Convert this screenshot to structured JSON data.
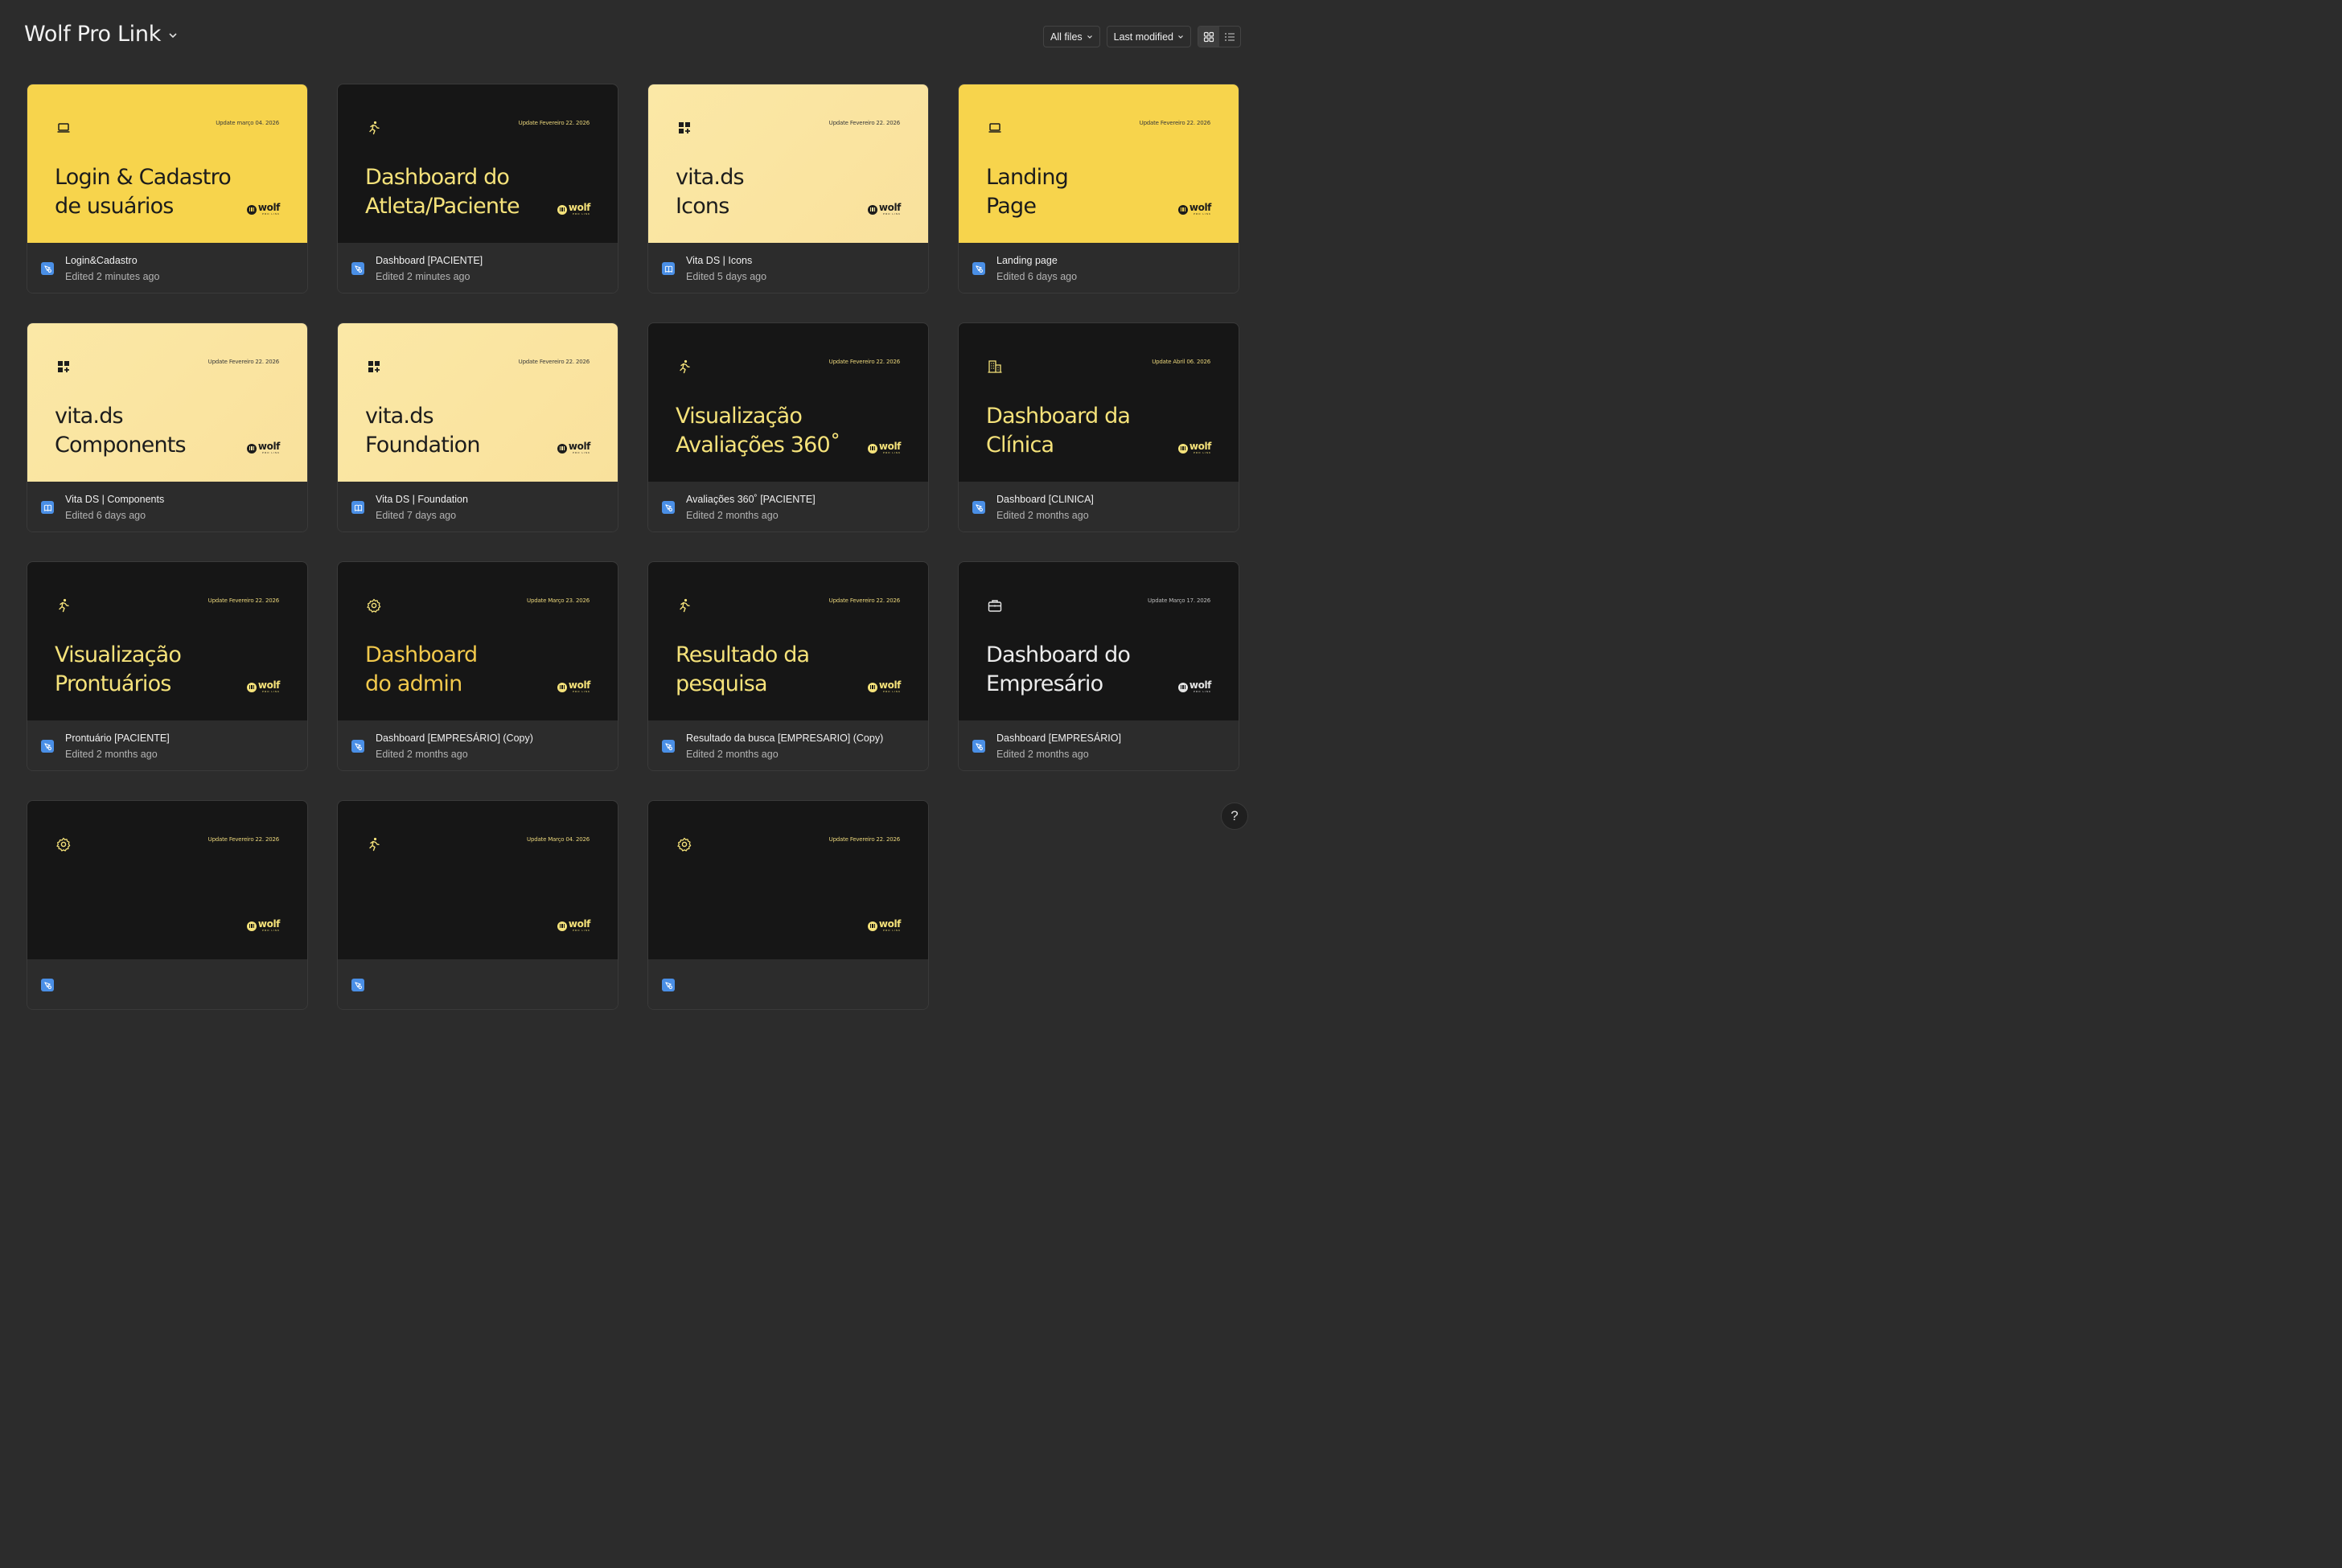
{
  "header": {
    "project_title": "Wolf Pro Link",
    "filter_label": "All files",
    "sort_label": "Last modified"
  },
  "colors": {
    "background": "#2c2c2c",
    "yellow": "#f7d44c",
    "cream": "#fbe8a6",
    "dark": "#161616",
    "accent_text": "#f5e27a",
    "file_icon_blue": "#4a8fe6"
  },
  "files": [
    {
      "theme": "yellow",
      "icon": "laptop-icon",
      "date": "Update março 04. 2026",
      "title": [
        "Login & Cadastro",
        "de usuários"
      ],
      "title_color": "dark",
      "file_type": "design-file-icon",
      "name": "Login&Cadastro",
      "edited": "Edited 2 minutes ago"
    },
    {
      "theme": "dark",
      "icon": "running-person-icon",
      "date": "Update Fevereiro 22. 2026",
      "title": [
        "Dashboard do",
        "Atleta/Paciente"
      ],
      "title_color": "yellow",
      "file_type": "design-file-icon",
      "name": "Dashboard [PACIENTE]",
      "edited": "Edited 2 minutes ago"
    },
    {
      "theme": "cream",
      "icon": "widgets-icon",
      "date": "Update Fevereiro 22. 2026",
      "title": [
        "vita.ds",
        "Icons"
      ],
      "title_color": "dark",
      "file_type": "library-file-icon",
      "name": "Vita DS | Icons",
      "edited": "Edited 5 days ago"
    },
    {
      "theme": "yellow",
      "icon": "laptop-icon",
      "date": "Update Fevereiro 22. 2026",
      "title": [
        "Landing",
        "Page"
      ],
      "title_color": "dark",
      "file_type": "design-file-icon",
      "name": "Landing page",
      "edited": "Edited 6 days ago"
    },
    {
      "theme": "cream",
      "icon": "widgets-icon",
      "date": "Update Fevereiro 22. 2026",
      "title": [
        "vita.ds",
        "Components"
      ],
      "title_color": "dark",
      "file_type": "library-file-icon",
      "name": "Vita DS | Components",
      "edited": "Edited 6 days ago"
    },
    {
      "theme": "cream",
      "icon": "widgets-icon",
      "date": "Update Fevereiro 22. 2026",
      "title": [
        "vita.ds",
        "Foundation"
      ],
      "title_color": "dark",
      "file_type": "library-file-icon",
      "name": "Vita DS | Foundation",
      "edited": "Edited 7 days ago"
    },
    {
      "theme": "dark",
      "icon": "running-person-icon",
      "date": "Update Fevereiro 22. 2026",
      "title": [
        "Visualização",
        "Avaliações 360˚"
      ],
      "title_color": "yellow",
      "file_type": "design-file-icon",
      "name": "Avaliações 360˚ [PACIENTE]",
      "edited": "Edited 2 months ago"
    },
    {
      "theme": "dark",
      "icon": "building-icon",
      "date": "Update Abril 06. 2026",
      "title": [
        "Dashboard da",
        "Clínica"
      ],
      "title_color": "yellow",
      "file_type": "design-file-icon",
      "name": "Dashboard [CLINICA]",
      "edited": "Edited 2 months ago"
    },
    {
      "theme": "dark",
      "icon": "running-person-icon",
      "date": "Update Fevereiro 22. 2026",
      "title": [
        "Visualização",
        "Prontuários"
      ],
      "title_color": "yellow",
      "file_type": "design-file-icon",
      "name": "Prontuário [PACIENTE]",
      "edited": "Edited 2 months ago"
    },
    {
      "theme": "dark",
      "icon": "gear-icon",
      "date": "Update Março 23. 2026",
      "title": [
        "Dashboard",
        "do admin"
      ],
      "title_color": "gold",
      "file_type": "design-file-icon",
      "name": "Dashboard [EMPRESÁRIO] (Copy)",
      "edited": "Edited 2 months ago"
    },
    {
      "theme": "dark",
      "icon": "running-person-icon",
      "date": "Update Fevereiro 22. 2026",
      "title": [
        "Resultado da",
        "pesquisa"
      ],
      "title_color": "yellow",
      "file_type": "design-file-icon",
      "name": "Resultado da busca [EMPRESARIO] (Copy)",
      "edited": "Edited 2 months ago"
    },
    {
      "theme": "dark",
      "icon": "briefcase-icon",
      "date": "Update Março 17. 2026",
      "title": [
        "Dashboard do",
        "Empresário"
      ],
      "title_color": "white",
      "file_type": "design-file-icon",
      "name": "Dashboard [EMPRESÁRIO]",
      "edited": "Edited 2 months ago"
    },
    {
      "theme": "dark",
      "icon": "gear-icon",
      "date": "Update Fevereiro 22. 2026",
      "title": [
        "",
        ""
      ],
      "title_color": "gold",
      "file_type": "design-file-icon",
      "name": "",
      "edited": ""
    },
    {
      "theme": "dark",
      "icon": "running-person-icon",
      "date": "Update Março 04. 2026",
      "title": [
        "",
        ""
      ],
      "title_color": "yellow",
      "file_type": "design-file-icon",
      "name": "",
      "edited": ""
    },
    {
      "theme": "dark",
      "icon": "gear-icon",
      "date": "Update Fevereiro 22. 2026",
      "title": [
        "",
        ""
      ],
      "title_color": "gold",
      "file_type": "design-file-icon",
      "name": "",
      "edited": ""
    }
  ],
  "help_label": "?"
}
